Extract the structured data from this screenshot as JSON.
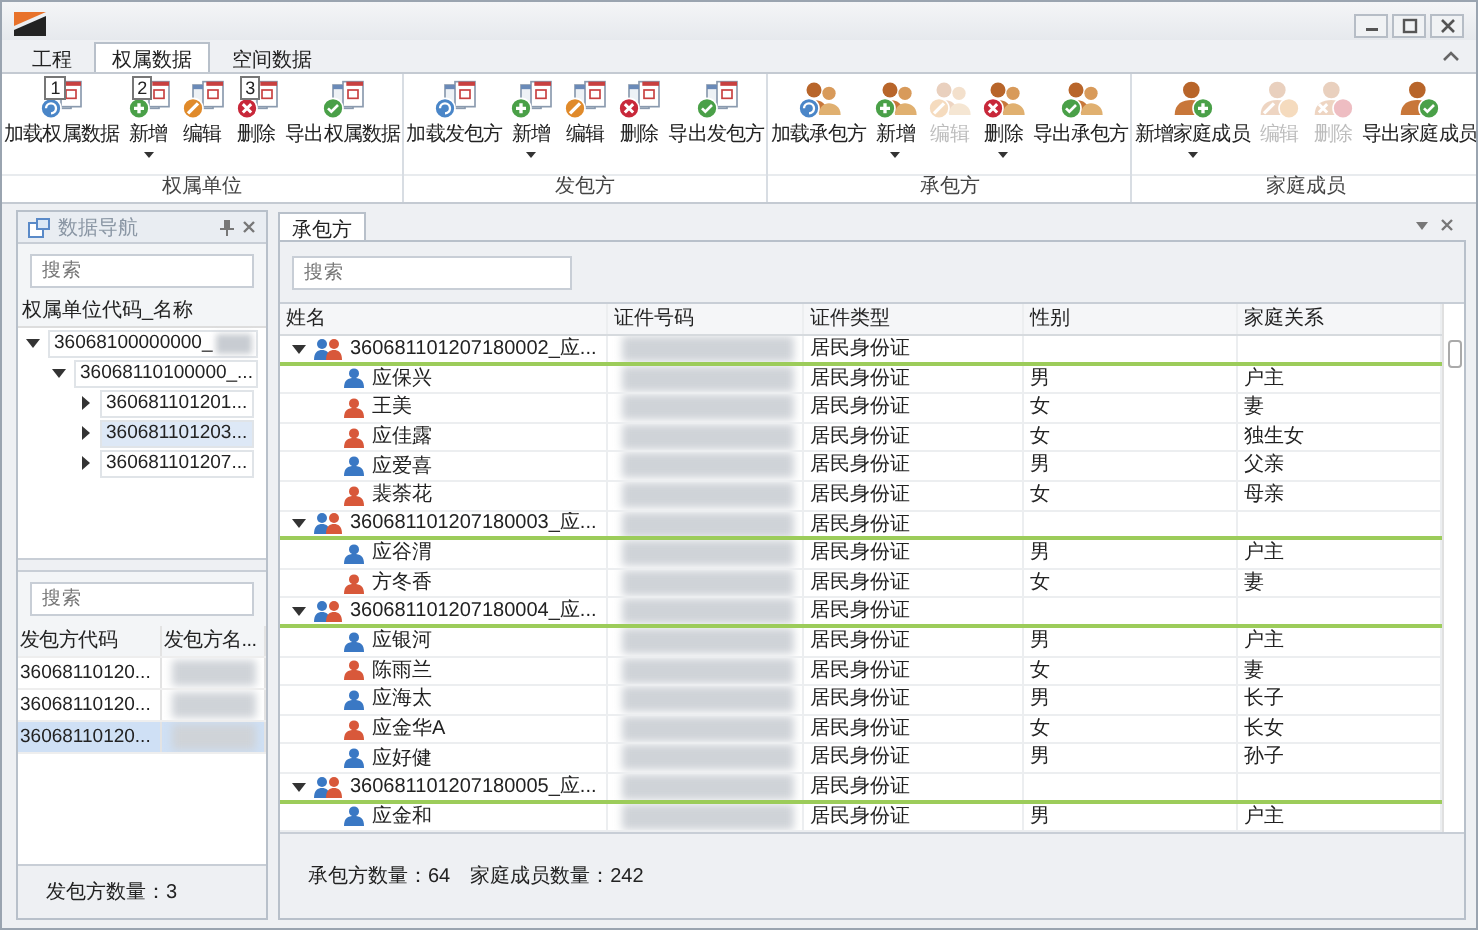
{
  "ribbon_tabs": [
    {
      "label": "工程",
      "selected": false
    },
    {
      "label": "权属数据",
      "selected": true
    },
    {
      "label": "空间数据",
      "selected": false
    }
  ],
  "ribbon_groups": [
    {
      "label": "权属单位",
      "kind": "document",
      "buttons": [
        {
          "label": "加载权属数据",
          "kind": "load",
          "keytip": "1",
          "dropdown": false,
          "disabled": false
        },
        {
          "label": "新增",
          "kind": "add",
          "keytip": "2",
          "dropdown": true,
          "disabled": false
        },
        {
          "label": "编辑",
          "kind": "edit",
          "dropdown": false,
          "disabled": false
        },
        {
          "label": "删除",
          "kind": "delete",
          "keytip": "3",
          "dropdown": false,
          "disabled": false
        },
        {
          "label": "导出权属数据",
          "kind": "export",
          "dropdown": false,
          "disabled": false
        }
      ]
    },
    {
      "label": "发包方",
      "kind": "document",
      "buttons": [
        {
          "label": "加载发包方",
          "kind": "load",
          "dropdown": false,
          "disabled": false
        },
        {
          "label": "新增",
          "kind": "add",
          "dropdown": true,
          "disabled": false
        },
        {
          "label": "编辑",
          "kind": "edit",
          "dropdown": false,
          "disabled": false
        },
        {
          "label": "删除",
          "kind": "delete",
          "dropdown": false,
          "disabled": false
        },
        {
          "label": "导出发包方",
          "kind": "export",
          "dropdown": false,
          "disabled": false
        }
      ]
    },
    {
      "label": "承包方",
      "kind": "people",
      "buttons": [
        {
          "label": "加载承包方",
          "kind": "load",
          "dropdown": false,
          "disabled": false
        },
        {
          "label": "新增",
          "kind": "add",
          "dropdown": true,
          "disabled": false
        },
        {
          "label": "编辑",
          "kind": "edit",
          "dropdown": false,
          "disabled": true
        },
        {
          "label": "删除",
          "kind": "delete",
          "dropdown": true,
          "disabled": false
        },
        {
          "label": "导出承包方",
          "kind": "export",
          "dropdown": false,
          "disabled": false
        }
      ]
    },
    {
      "label": "家庭成员",
      "kind": "person",
      "buttons": [
        {
          "label": "新增家庭成员",
          "kind": "add",
          "dropdown": true,
          "disabled": false
        },
        {
          "label": "编辑",
          "kind": "edit",
          "dropdown": false,
          "disabled": true
        },
        {
          "label": "删除",
          "kind": "delete",
          "dropdown": false,
          "disabled": true
        },
        {
          "label": "导出家庭成员",
          "kind": "export",
          "dropdown": false,
          "disabled": false
        }
      ]
    }
  ],
  "nav_panel": {
    "title": "数据导航",
    "search_placeholder": "搜索",
    "tree_header": "权属单位代码_名称",
    "tree": [
      {
        "label": "36068100000000_",
        "redacted": true,
        "expanded": true,
        "selected": false,
        "children": [
          {
            "label": "36068110100000_...",
            "redacted": false,
            "expanded": true,
            "selected": false,
            "children": [
              {
                "label": "360681101201...",
                "redacted": false,
                "expanded": false,
                "selected": false
              },
              {
                "label": "360681101203...",
                "redacted": false,
                "expanded": false,
                "selected": true
              },
              {
                "label": "360681101207...",
                "redacted": false,
                "expanded": false,
                "selected": false
              }
            ]
          }
        ]
      }
    ],
    "lower_search_placeholder": "搜索",
    "columns": [
      "发包方代码",
      "发包方名..."
    ],
    "rows": [
      {
        "code": "36068110120...",
        "selected": false
      },
      {
        "code": "36068110120...",
        "selected": false
      },
      {
        "code": "36068110120...",
        "selected": true
      }
    ],
    "footer": "发包方数量：3"
  },
  "main_panel": {
    "tab": {
      "label": "承包方",
      "selected": true
    },
    "search_placeholder": "搜索",
    "columns": [
      "姓名",
      "证件号码",
      "证件类型",
      "性别",
      "家庭关系"
    ],
    "rows": [
      {
        "kind": "group",
        "name": "360681101207180002_应...",
        "id_type": "居民身份证",
        "expanded": true
      },
      {
        "kind": "member",
        "name": "应保兴",
        "id_type": "居民身份证",
        "gender": "男",
        "relation": "户主",
        "color": "#3a78c4"
      },
      {
        "kind": "member",
        "name": "王美",
        "id_type": "居民身份证",
        "gender": "女",
        "relation": "妻",
        "color": "#d8583a"
      },
      {
        "kind": "member",
        "name": "应佳露",
        "id_type": "居民身份证",
        "gender": "女",
        "relation": "独生女",
        "color": "#d8583a"
      },
      {
        "kind": "member",
        "name": "应爱喜",
        "id_type": "居民身份证",
        "gender": "男",
        "relation": "父亲",
        "color": "#3a78c4"
      },
      {
        "kind": "member",
        "name": "裴荼花",
        "id_type": "居民身份证",
        "gender": "女",
        "relation": "母亲",
        "color": "#d8583a"
      },
      {
        "kind": "group",
        "name": "360681101207180003_应...",
        "id_type": "居民身份证",
        "expanded": true
      },
      {
        "kind": "member",
        "name": "应谷渭",
        "id_type": "居民身份证",
        "gender": "男",
        "relation": "户主",
        "color": "#3a78c4"
      },
      {
        "kind": "member",
        "name": "方冬香",
        "id_type": "居民身份证",
        "gender": "女",
        "relation": "妻",
        "color": "#d8583a"
      },
      {
        "kind": "group",
        "name": "360681101207180004_应...",
        "id_type": "居民身份证",
        "expanded": true
      },
      {
        "kind": "member",
        "name": "应银河",
        "id_type": "居民身份证",
        "gender": "男",
        "relation": "户主",
        "color": "#3a78c4"
      },
      {
        "kind": "member",
        "name": "陈雨兰",
        "id_type": "居民身份证",
        "gender": "女",
        "relation": "妻",
        "color": "#d8583a"
      },
      {
        "kind": "member",
        "name": "应海太",
        "id_type": "居民身份证",
        "gender": "男",
        "relation": "长子",
        "color": "#3a78c4"
      },
      {
        "kind": "member",
        "name": "应金华A",
        "id_type": "居民身份证",
        "gender": "女",
        "relation": "长女",
        "color": "#d8583a"
      },
      {
        "kind": "member",
        "name": "应好健",
        "id_type": "居民身份证",
        "gender": "男",
        "relation": "孙子",
        "color": "#3a78c4"
      },
      {
        "kind": "group",
        "name": "360681101207180005_应...",
        "id_type": "居民身份证",
        "expanded": true
      },
      {
        "kind": "member",
        "name": "应金和",
        "id_type": "居民身份证",
        "gender": "男",
        "relation": "户主",
        "color": "#3a78c4"
      }
    ],
    "footer": [
      "承包方数量：64",
      "家庭成员数量：242"
    ]
  }
}
